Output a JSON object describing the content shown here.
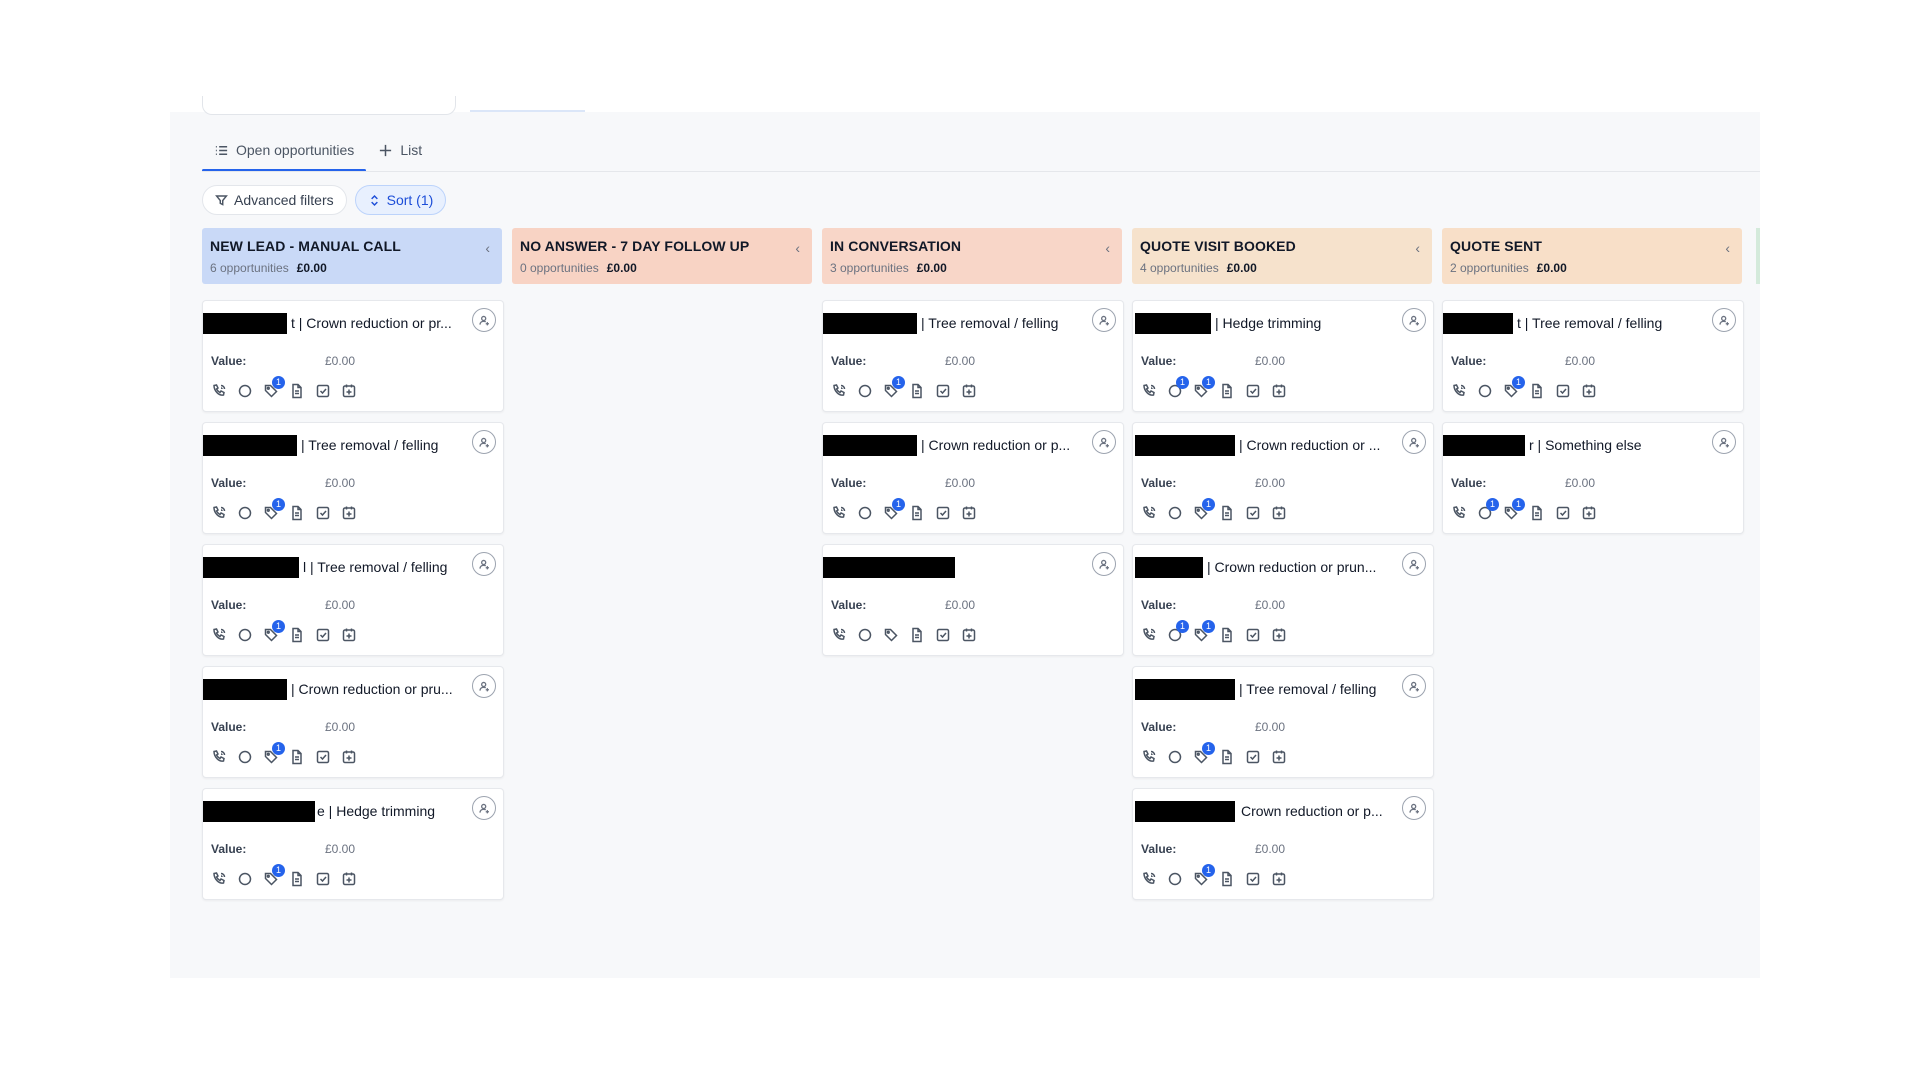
{
  "tabs": [
    {
      "label": "Open opportunities",
      "active": true
    },
    {
      "label": "List",
      "active": false
    }
  ],
  "filters": {
    "advanced_label": "Advanced filters",
    "sort_label": "Sort (1)"
  },
  "value_label": "Value:",
  "columns": [
    {
      "title": "NEW LEAD - MANUAL CALL",
      "count": "6 opportunities",
      "total": "£0.00",
      "color": "#c9d9f7",
      "cards": [
        {
          "name": "t | Crown reduction or pr...",
          "value": "£0.00",
          "badges": {
            "tag": "1"
          }
        },
        {
          "name": "| Tree removal / felling",
          "value": "£0.00",
          "badges": {
            "tag": "1"
          }
        },
        {
          "name": "l | Tree removal / felling",
          "value": "£0.00",
          "badges": {
            "tag": "1"
          }
        },
        {
          "name": "| Crown reduction or pru...",
          "value": "£0.00",
          "badges": {
            "tag": "1"
          }
        },
        {
          "name": "e | Hedge trimming",
          "value": "£0.00",
          "badges": {
            "tag": "1"
          }
        }
      ]
    },
    {
      "title": "NO ANSWER - 7 DAY FOLLOW UP",
      "count": "0 opportunities",
      "total": "£0.00",
      "color": "#f8d3c4",
      "cards": []
    },
    {
      "title": "IN CONVERSATION",
      "count": "3 opportunities",
      "total": "£0.00",
      "color": "#f8d6c8",
      "cards": [
        {
          "name": "| Tree removal / felling",
          "value": "£0.00",
          "badges": {
            "tag": "1"
          }
        },
        {
          "name": "| Crown reduction or p...",
          "value": "£0.00",
          "badges": {
            "tag": "1"
          }
        },
        {
          "name": "",
          "value": "£0.00",
          "badges": {}
        }
      ]
    },
    {
      "title": "QUOTE VISIT BOOKED",
      "count": "4 opportunities",
      "total": "£0.00",
      "color": "#f6e2cc",
      "cards": [
        {
          "name": "| Hedge trimming",
          "value": "£0.00",
          "badges": {
            "chat": "1",
            "tag": "1"
          }
        },
        {
          "name": "| Crown reduction or ...",
          "value": "£0.00",
          "badges": {
            "tag": "1"
          }
        },
        {
          "name": "| Crown reduction or prun...",
          "value": "£0.00",
          "badges": {
            "chat": "1",
            "tag": "1"
          }
        },
        {
          "name": "| Tree removal / felling",
          "value": "£0.00",
          "badges": {
            "tag": "1"
          }
        },
        {
          "name": "Crown reduction or p...",
          "value": "£0.00",
          "badges": {
            "tag": "1"
          }
        }
      ]
    },
    {
      "title": "QUOTE SENT",
      "count": "2 opportunities",
      "total": "£0.00",
      "color": "#f8dfc8",
      "cards": [
        {
          "name": "t | Tree removal / felling",
          "value": "£0.00",
          "badges": {
            "tag": "1"
          }
        },
        {
          "name": "r | Something else",
          "value": "£0.00",
          "badges": {
            "chat": "1",
            "tag": "1"
          }
        }
      ]
    }
  ]
}
